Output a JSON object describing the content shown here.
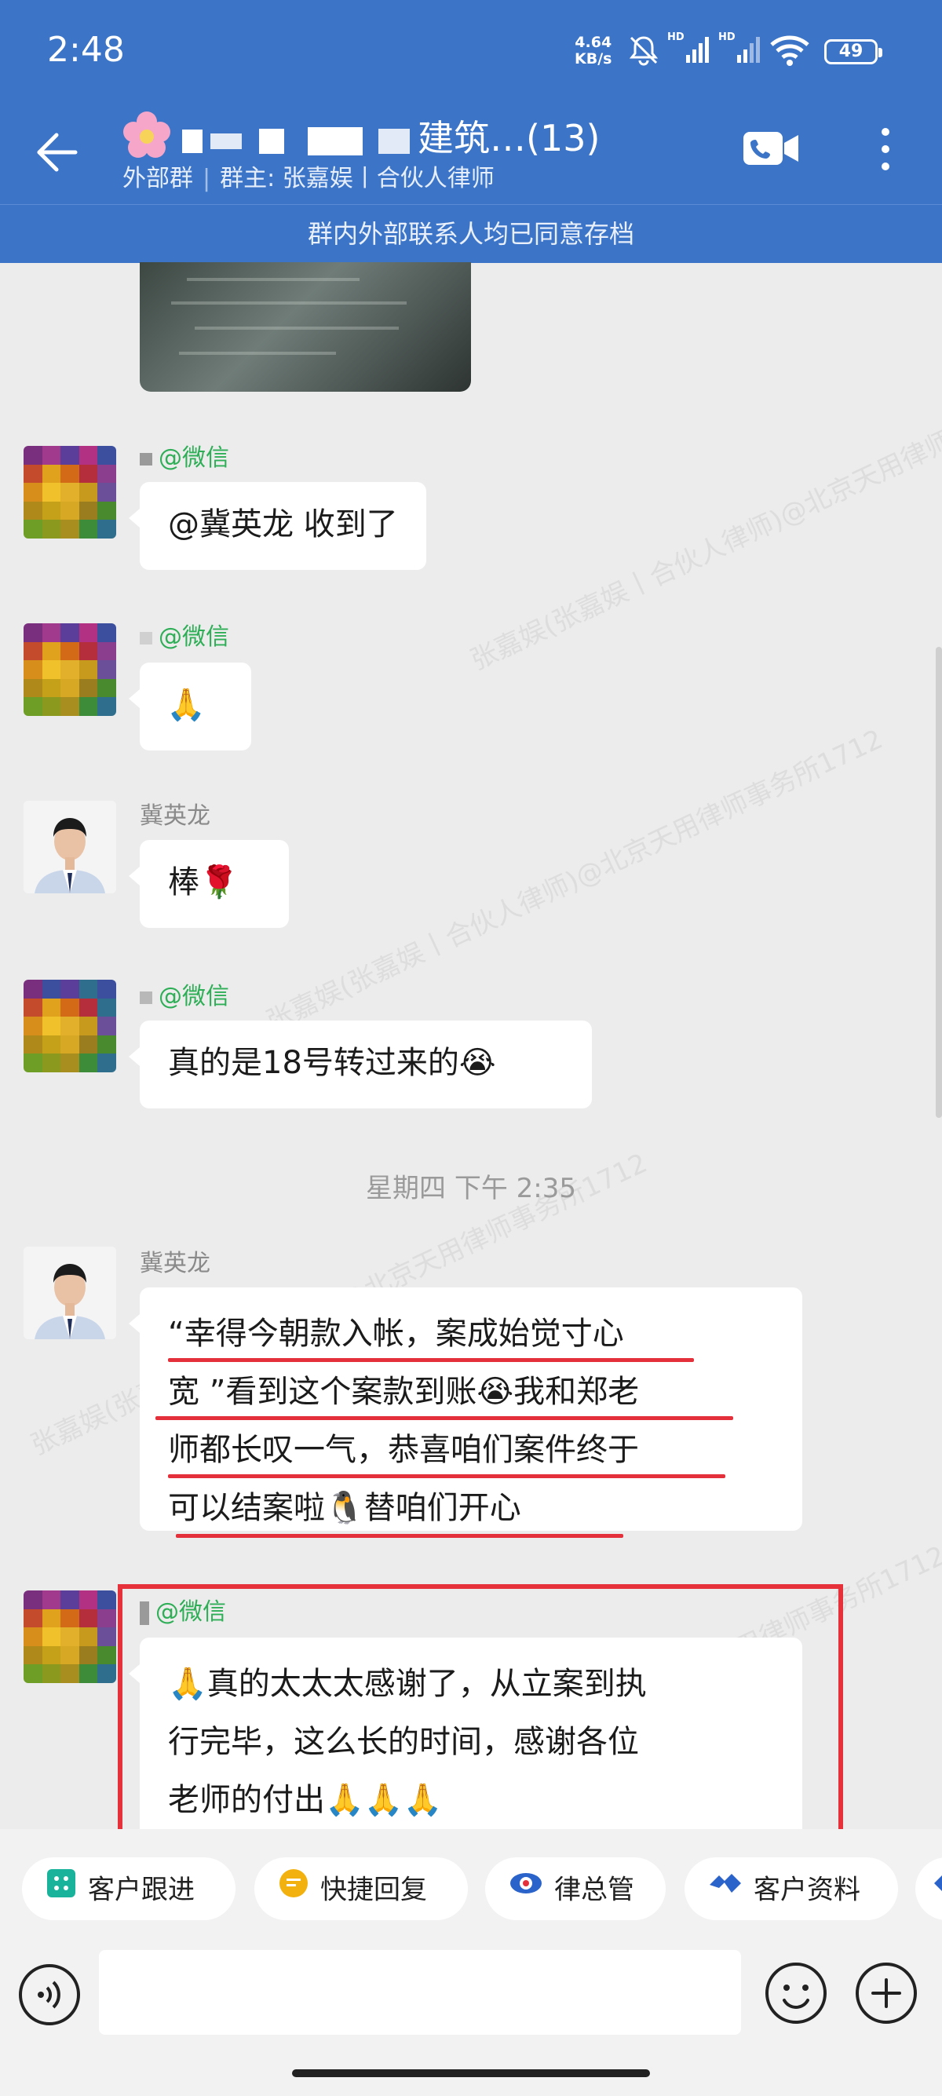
{
  "status_bar": {
    "time": "2:48",
    "net_speed_value": "4.64",
    "net_speed_unit": "KB/s",
    "hd1": "HD",
    "hd2": "HD",
    "battery": "49"
  },
  "header": {
    "group_name_visible": "建筑…(13)",
    "group_tag": "外部群",
    "owner": "群主: 张嘉娱丨合伙人律师",
    "notice": "群内外部联系人均已同意存档"
  },
  "watermark": "张嘉娱(张嘉娱丨合伙人律师)@北京天用律师事务所1712",
  "messages": [
    {
      "sender": "@微信",
      "text": "@冀英龙 收到了"
    },
    {
      "sender": "@微信",
      "text": "🙏"
    },
    {
      "sender": "冀英龙",
      "text": "棒🌹"
    },
    {
      "sender": "@微信",
      "text": "真的是18号转过来的😭"
    },
    {
      "sender": "冀英龙",
      "lines": [
        "“幸得今朝款入帐，案成始觉寸心",
        "宽 ”看到这个案款到账😭我和郑老",
        "师都长叹一气，恭喜咱们案件终于",
        "可以结案啦🐧替咱们开心"
      ]
    },
    {
      "sender": "@微信",
      "lines": [
        "🙏真的太太太感谢了，从立案到执",
        "行完毕，这么长的时间，感谢各位",
        "老师的付出🙏🙏🙏"
      ]
    }
  ],
  "time_separator": "星期四  下午 2:35",
  "quick_actions": [
    "客户跟进",
    "快捷回复",
    "律总管",
    "客户资料"
  ],
  "input": {
    "placeholder": ""
  },
  "colors": {
    "header": "#3c75c8",
    "wechat_green": "#2eae56",
    "highlight_red": "#e6313b"
  }
}
